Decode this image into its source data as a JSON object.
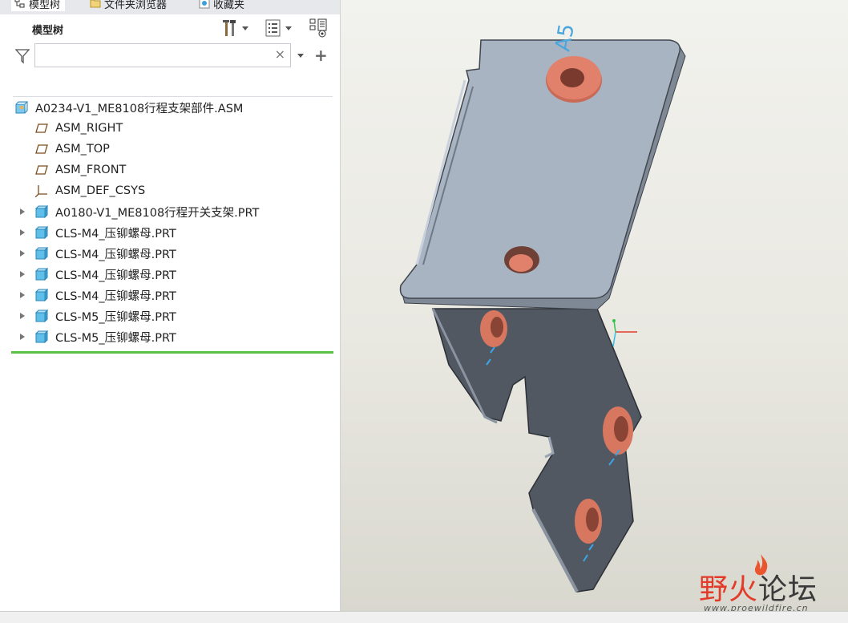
{
  "tabs": [
    {
      "label": "模型树"
    },
    {
      "label": "文件夹浏览器"
    },
    {
      "label": "收藏夹"
    }
  ],
  "panel": {
    "title": "模型树",
    "search_value": "",
    "clear_symbol": "×",
    "add_symbol": "+"
  },
  "tree": {
    "root": {
      "label": "A0234-V1_ME8108行程支架部件.ASM",
      "icon": "assembly-icon"
    },
    "items": [
      {
        "label": "ASM_RIGHT",
        "icon": "datum-plane-icon",
        "expandable": false
      },
      {
        "label": "ASM_TOP",
        "icon": "datum-plane-icon",
        "expandable": false
      },
      {
        "label": "ASM_FRONT",
        "icon": "datum-plane-icon",
        "expandable": false
      },
      {
        "label": "ASM_DEF_CSYS",
        "icon": "coordinate-system-icon",
        "expandable": false
      },
      {
        "label": "A0180-V1_ME8108行程开关支架.PRT",
        "icon": "part-icon",
        "expandable": true
      },
      {
        "label": "CLS-M4_压铆螺母.PRT",
        "icon": "part-icon",
        "expandable": true
      },
      {
        "label": "CLS-M4_压铆螺母.PRT",
        "icon": "part-icon",
        "expandable": true
      },
      {
        "label": "CLS-M4_压铆螺母.PRT",
        "icon": "part-icon",
        "expandable": true
      },
      {
        "label": "CLS-M4_压铆螺母.PRT",
        "icon": "part-icon",
        "expandable": true
      },
      {
        "label": "CLS-M5_压铆螺母.PRT",
        "icon": "part-icon",
        "expandable": true
      },
      {
        "label": "CLS-M5_压铆螺母.PRT",
        "icon": "part-icon",
        "expandable": true
      }
    ]
  },
  "viewport": {
    "annotation_text": "A5",
    "watermark_cn_1": "野",
    "watermark_cn_2": "火",
    "watermark_cn_3": "论坛",
    "watermark_url": "www.proewildfire.cn"
  },
  "colors": {
    "accent_green": "#5ac145",
    "plate_light": "#a6b2c1",
    "plate_dark": "#525862",
    "nut_orange": "#e2816b"
  }
}
